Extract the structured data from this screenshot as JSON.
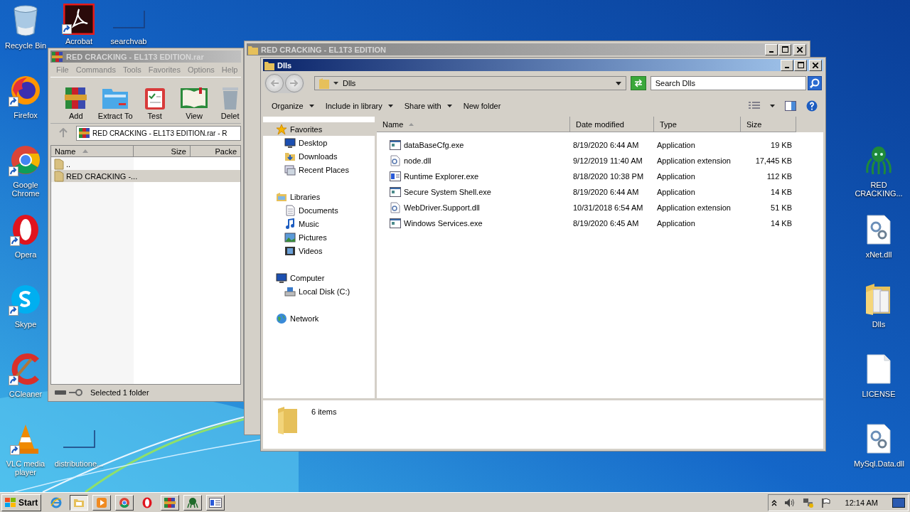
{
  "desktop": {
    "left_column": [
      {
        "label": "Recycle Bin",
        "kind": "recycle",
        "shortcut": false
      },
      {
        "label": "Firefox",
        "kind": "firefox",
        "shortcut": true
      },
      {
        "label": "Google Chrome",
        "kind": "chrome",
        "shortcut": true
      },
      {
        "label": "Opera",
        "kind": "opera",
        "shortcut": true
      },
      {
        "label": "Skype",
        "kind": "skype",
        "shortcut": true
      },
      {
        "label": "CCleaner",
        "kind": "ccleaner",
        "shortcut": true
      },
      {
        "label": "VLC media player",
        "kind": "vlc",
        "shortcut": true
      }
    ],
    "top_row": [
      {
        "label": "Acrobat",
        "kind": "acrobat",
        "shortcut": true
      },
      {
        "label": "searchvab",
        "kind": "blank",
        "shortcut": false
      }
    ],
    "bottom_row": [
      {
        "label": "distributione...",
        "kind": "blank",
        "shortcut": false
      }
    ],
    "right_column": [
      {
        "label": "RED CRACKING...",
        "kind": "octopus",
        "shortcut": false
      },
      {
        "label": "xNet.dll",
        "kind": "dll",
        "shortcut": false
      },
      {
        "label": "Dlls",
        "kind": "folder",
        "shortcut": false
      },
      {
        "label": "LICENSE",
        "kind": "document",
        "shortcut": false
      },
      {
        "label": "MySql.Data.dll",
        "kind": "dll",
        "shortcut": false
      }
    ]
  },
  "winrar": {
    "title": "RED CRACKING - EL1T3 EDITION.rar",
    "menu": [
      "File",
      "Commands",
      "Tools",
      "Favorites",
      "Options",
      "Help"
    ],
    "toolbar": [
      {
        "label": "Add",
        "kind": "add"
      },
      {
        "label": "Extract To",
        "kind": "extract"
      },
      {
        "label": "Test",
        "kind": "test"
      },
      {
        "label": "View",
        "kind": "view"
      },
      {
        "label": "Delet",
        "kind": "delete"
      }
    ],
    "address": "RED CRACKING - EL1T3 EDITION.rar - R",
    "columns": [
      {
        "label": "Name",
        "sorted": true
      },
      {
        "label": "Size",
        "sorted": false
      },
      {
        "label": "Packe",
        "sorted": false
      }
    ],
    "rows": [
      {
        "name": "..",
        "selected": false
      },
      {
        "name": "RED CRACKING -...",
        "selected": true
      }
    ],
    "status": "Selected 1 folder"
  },
  "back_window": {
    "title": "RED CRACKING - EL1T3 EDITION"
  },
  "explorer": {
    "title": "Dlls",
    "address": "Dlls",
    "search": {
      "placeholder": "Search Dlls"
    },
    "toolbar": [
      {
        "label": "Organize",
        "dropdown": true
      },
      {
        "label": "Include in library",
        "dropdown": true
      },
      {
        "label": "Share with",
        "dropdown": true
      },
      {
        "label": "New folder",
        "dropdown": false
      }
    ],
    "nav": [
      {
        "label": "Favorites",
        "kind": "favorites",
        "selected": true,
        "children": [
          {
            "label": "Desktop",
            "kind": "desktop",
            "selected": false
          },
          {
            "label": "Downloads",
            "kind": "downloads",
            "selected": false
          },
          {
            "label": "Recent Places",
            "kind": "recent",
            "selected": false
          }
        ]
      },
      {
        "label": "Libraries",
        "kind": "libraries",
        "selected": false,
        "children": [
          {
            "label": "Documents",
            "kind": "documents",
            "selected": false
          },
          {
            "label": "Music",
            "kind": "music",
            "selected": false
          },
          {
            "label": "Pictures",
            "kind": "pictures",
            "selected": false
          },
          {
            "label": "Videos",
            "kind": "videos",
            "selected": false
          }
        ]
      },
      {
        "label": "Computer",
        "kind": "computer",
        "selected": false,
        "children": [
          {
            "label": "Local Disk (C:)",
            "kind": "disk",
            "selected": false
          }
        ]
      },
      {
        "label": "Network",
        "kind": "network",
        "selected": false
      }
    ],
    "columns": [
      {
        "label": "Name",
        "sorted": true
      },
      {
        "label": "Date modified",
        "sorted": false
      },
      {
        "label": "Type",
        "sorted": false
      },
      {
        "label": "Size",
        "sorted": false
      }
    ],
    "files": [
      {
        "name": "dataBaseCfg.exe",
        "date": "8/19/2020 6:44 AM",
        "type": "Application",
        "size": "19 KB",
        "kind": "app"
      },
      {
        "name": "node.dll",
        "date": "9/12/2019 11:40 AM",
        "type": "Application extension",
        "size": "17,445 KB",
        "kind": "dll"
      },
      {
        "name": "Runtime Explorer.exe",
        "date": "8/18/2020 10:38 PM",
        "type": "Application",
        "size": "112 KB",
        "kind": "app-blue"
      },
      {
        "name": "Secure System Shell.exe",
        "date": "8/19/2020 6:44 AM",
        "type": "Application",
        "size": "14 KB",
        "kind": "app"
      },
      {
        "name": "WebDriver.Support.dll",
        "date": "10/31/2018 6:54 AM",
        "type": "Application extension",
        "size": "51 KB",
        "kind": "dll"
      },
      {
        "name": "Windows Services.exe",
        "date": "8/19/2020 6:45 AM",
        "type": "Application",
        "size": "14 KB",
        "kind": "app"
      }
    ],
    "details": {
      "count": "6 items"
    }
  },
  "taskbar": {
    "start": "Start",
    "apps": [
      {
        "kind": "ie",
        "running": false,
        "active": false
      },
      {
        "kind": "explorer",
        "running": true,
        "active": true
      },
      {
        "kind": "media",
        "running": true,
        "active": false
      },
      {
        "kind": "chrome",
        "running": true,
        "active": false
      },
      {
        "kind": "opera",
        "running": false,
        "active": false
      },
      {
        "kind": "winrar",
        "running": true,
        "active": false
      },
      {
        "kind": "octopus",
        "running": true,
        "active": false
      },
      {
        "kind": "window",
        "running": true,
        "active": false
      }
    ],
    "clock": "12:14 AM"
  }
}
